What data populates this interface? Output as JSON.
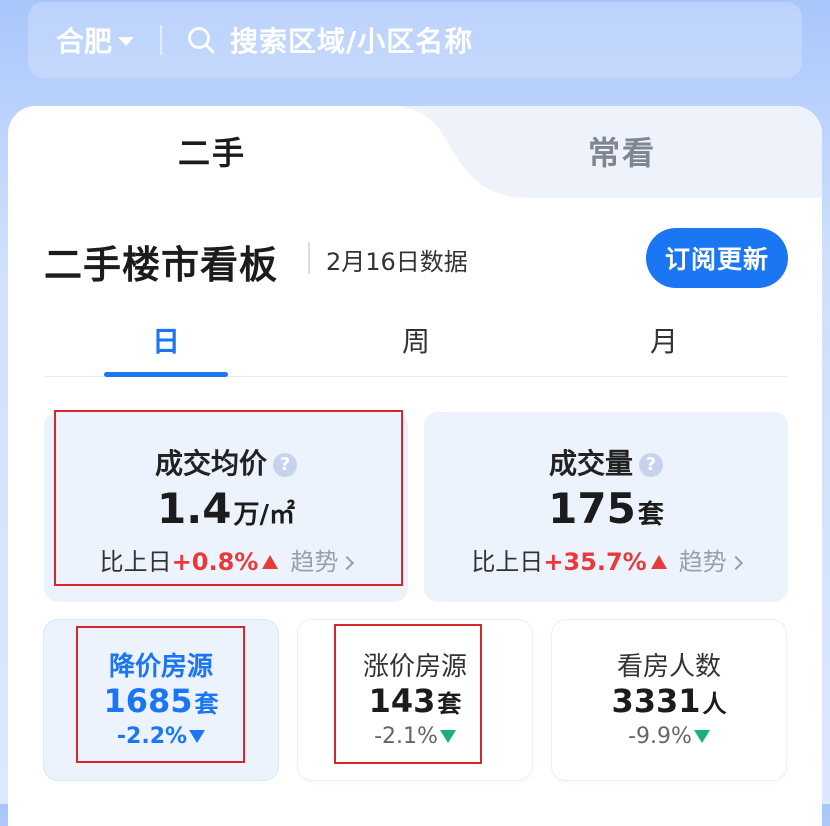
{
  "search": {
    "city": "合肥",
    "placeholder": "搜索区域/小区名称"
  },
  "tabs": [
    {
      "label": "二手",
      "active": true
    },
    {
      "label": "常看",
      "active": false
    }
  ],
  "board": {
    "title": "二手楼市看板",
    "date": "2月16日数据",
    "subscribe_label": "订阅更新"
  },
  "periods": [
    {
      "label": "日",
      "active": true
    },
    {
      "label": "周",
      "active": false
    },
    {
      "label": "月",
      "active": false
    }
  ],
  "stats": [
    {
      "title": "成交均价",
      "value": "1.4",
      "unit": "万/㎡",
      "compare_label": "比上日",
      "change": "+0.8%",
      "trend_label": "趋势"
    },
    {
      "title": "成交量",
      "value": "175",
      "unit": "套",
      "compare_label": "比上日",
      "change": "+35.7%",
      "trend_label": "趋势"
    }
  ],
  "mini_stats": [
    {
      "title": "降价房源",
      "value": "1685",
      "unit": "套",
      "change": "-2.2%"
    },
    {
      "title": "涨价房源",
      "value": "143",
      "unit": "套",
      "change": "-2.1%"
    },
    {
      "title": "看房人数",
      "value": "3331",
      "unit": "人",
      "change": "-9.9%"
    }
  ],
  "colors": {
    "accent": "#1a76f2",
    "up": "#e83a3a",
    "down": "#18b272",
    "highlight": "#d62828"
  }
}
